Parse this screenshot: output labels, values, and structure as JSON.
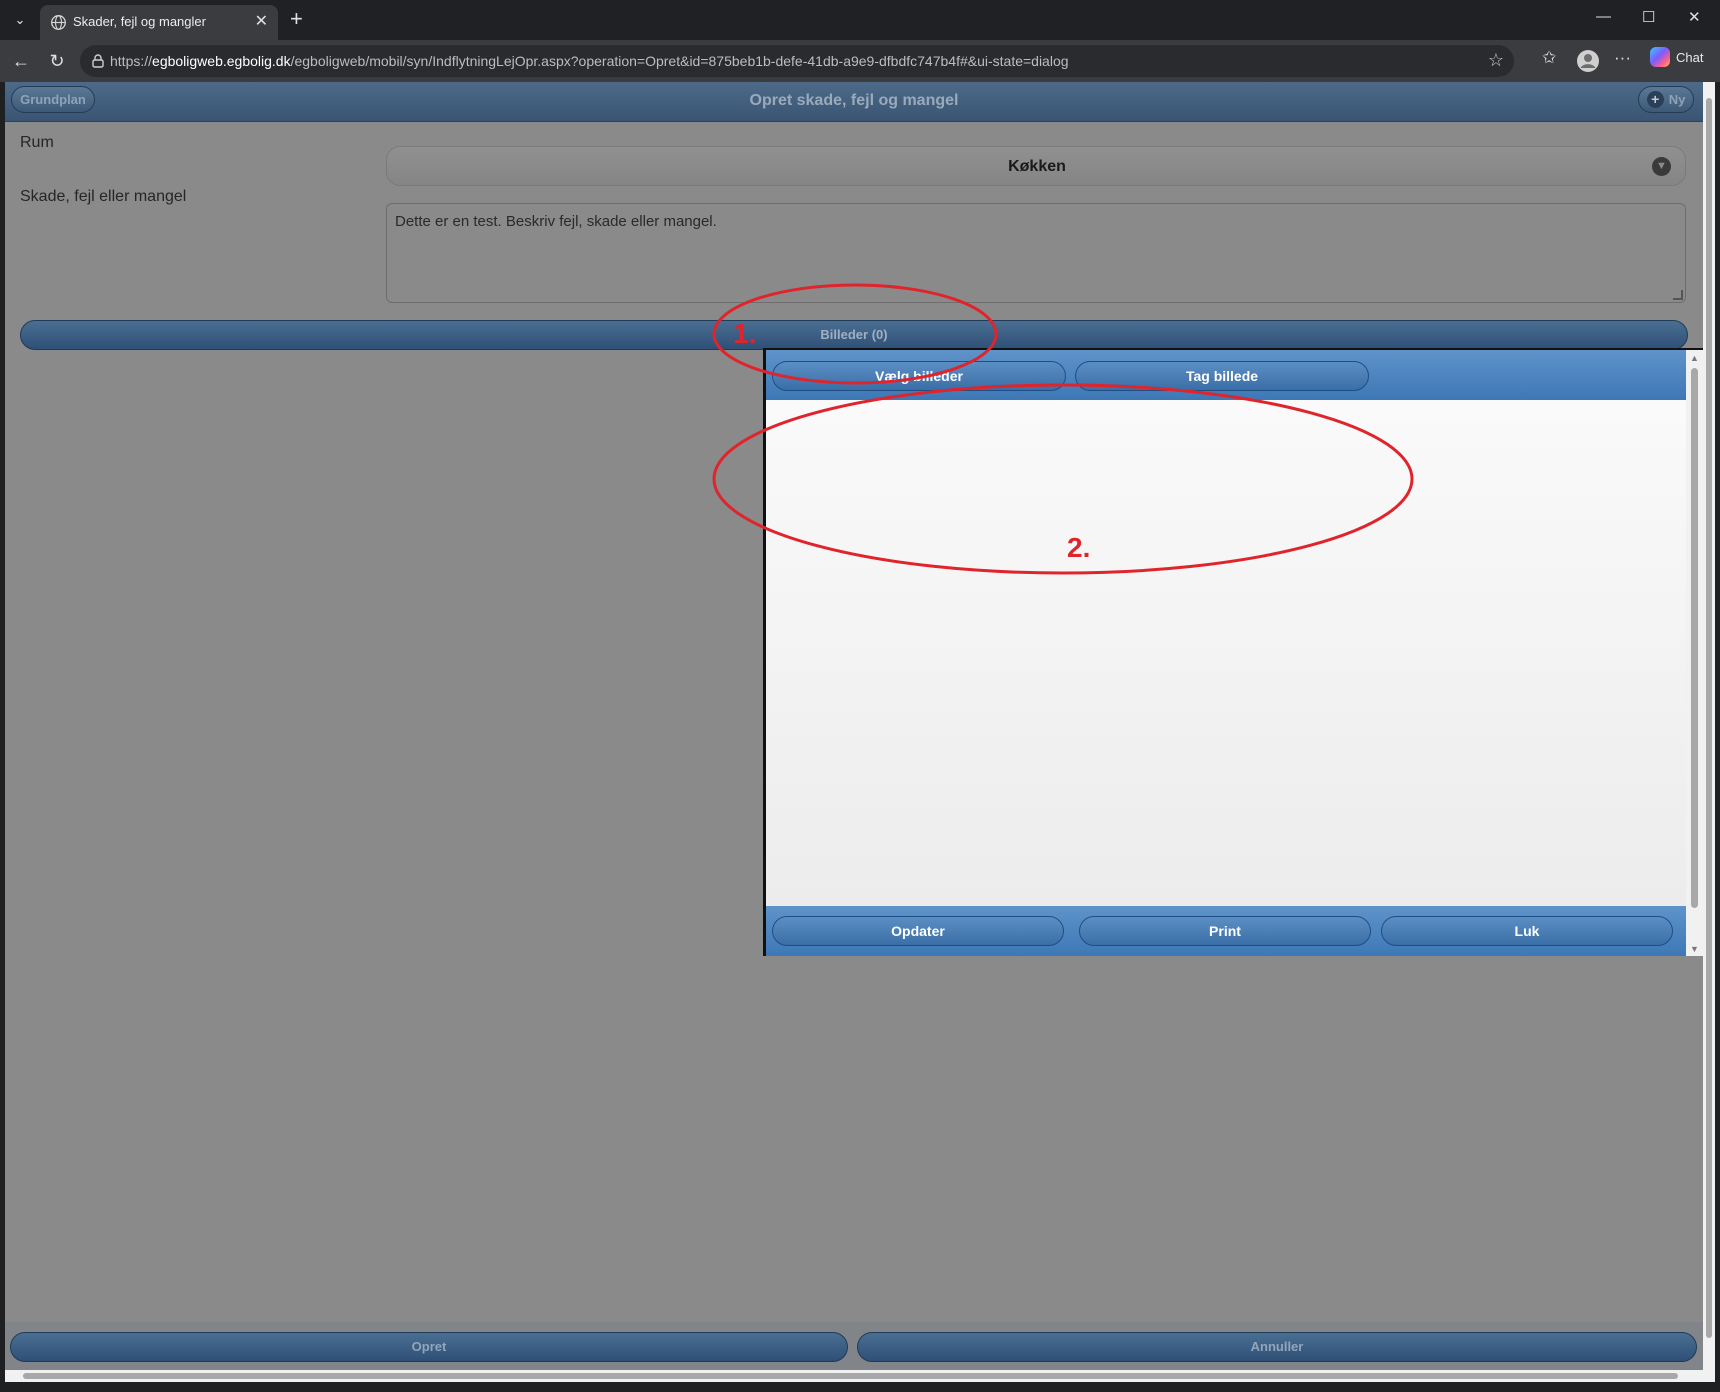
{
  "browser": {
    "tab_title": "Skader, fejl og mangler",
    "url_prefix": "https://",
    "url_host": "egboligweb.egbolig.dk",
    "url_path": "/egboligweb/mobil/syn/IndflytningLejOpr.aspx?operation=Opret&id=875beb1b-defe-41db-a9e9-dfbdfc747b4f#&ui-state=dialog",
    "chat_label": "Chat",
    "icons": [
      "tab-list-icon",
      "globe-icon",
      "close-icon",
      "new-tab-icon",
      "minimize-icon",
      "maximize-icon",
      "window-close-icon",
      "back-icon",
      "reload-icon",
      "lock-icon",
      "star-icon",
      "favorites-icon",
      "profile-icon",
      "more-icon",
      "copilot-icon"
    ]
  },
  "header": {
    "left_button": "Grundplan",
    "title": "Opret skade, fejl og mangel",
    "right_button": "Ny"
  },
  "form": {
    "room_label": "Rum",
    "room_value": "Køkken",
    "defect_label": "Skade, fejl eller mangel",
    "defect_value": "Dette er en test. Beskriv fejl, skade eller mangel.",
    "images_button": "Billeder (0)"
  },
  "dialog": {
    "choose_images": "Vælg billeder",
    "take_image": "Tag billede",
    "update": "Opdater",
    "print": "Print",
    "close": "Luk"
  },
  "footer": {
    "create": "Opret",
    "cancel": "Annuller"
  },
  "annotations": {
    "mark1": "1.",
    "mark2": "2.",
    "color": "#e0242c"
  }
}
